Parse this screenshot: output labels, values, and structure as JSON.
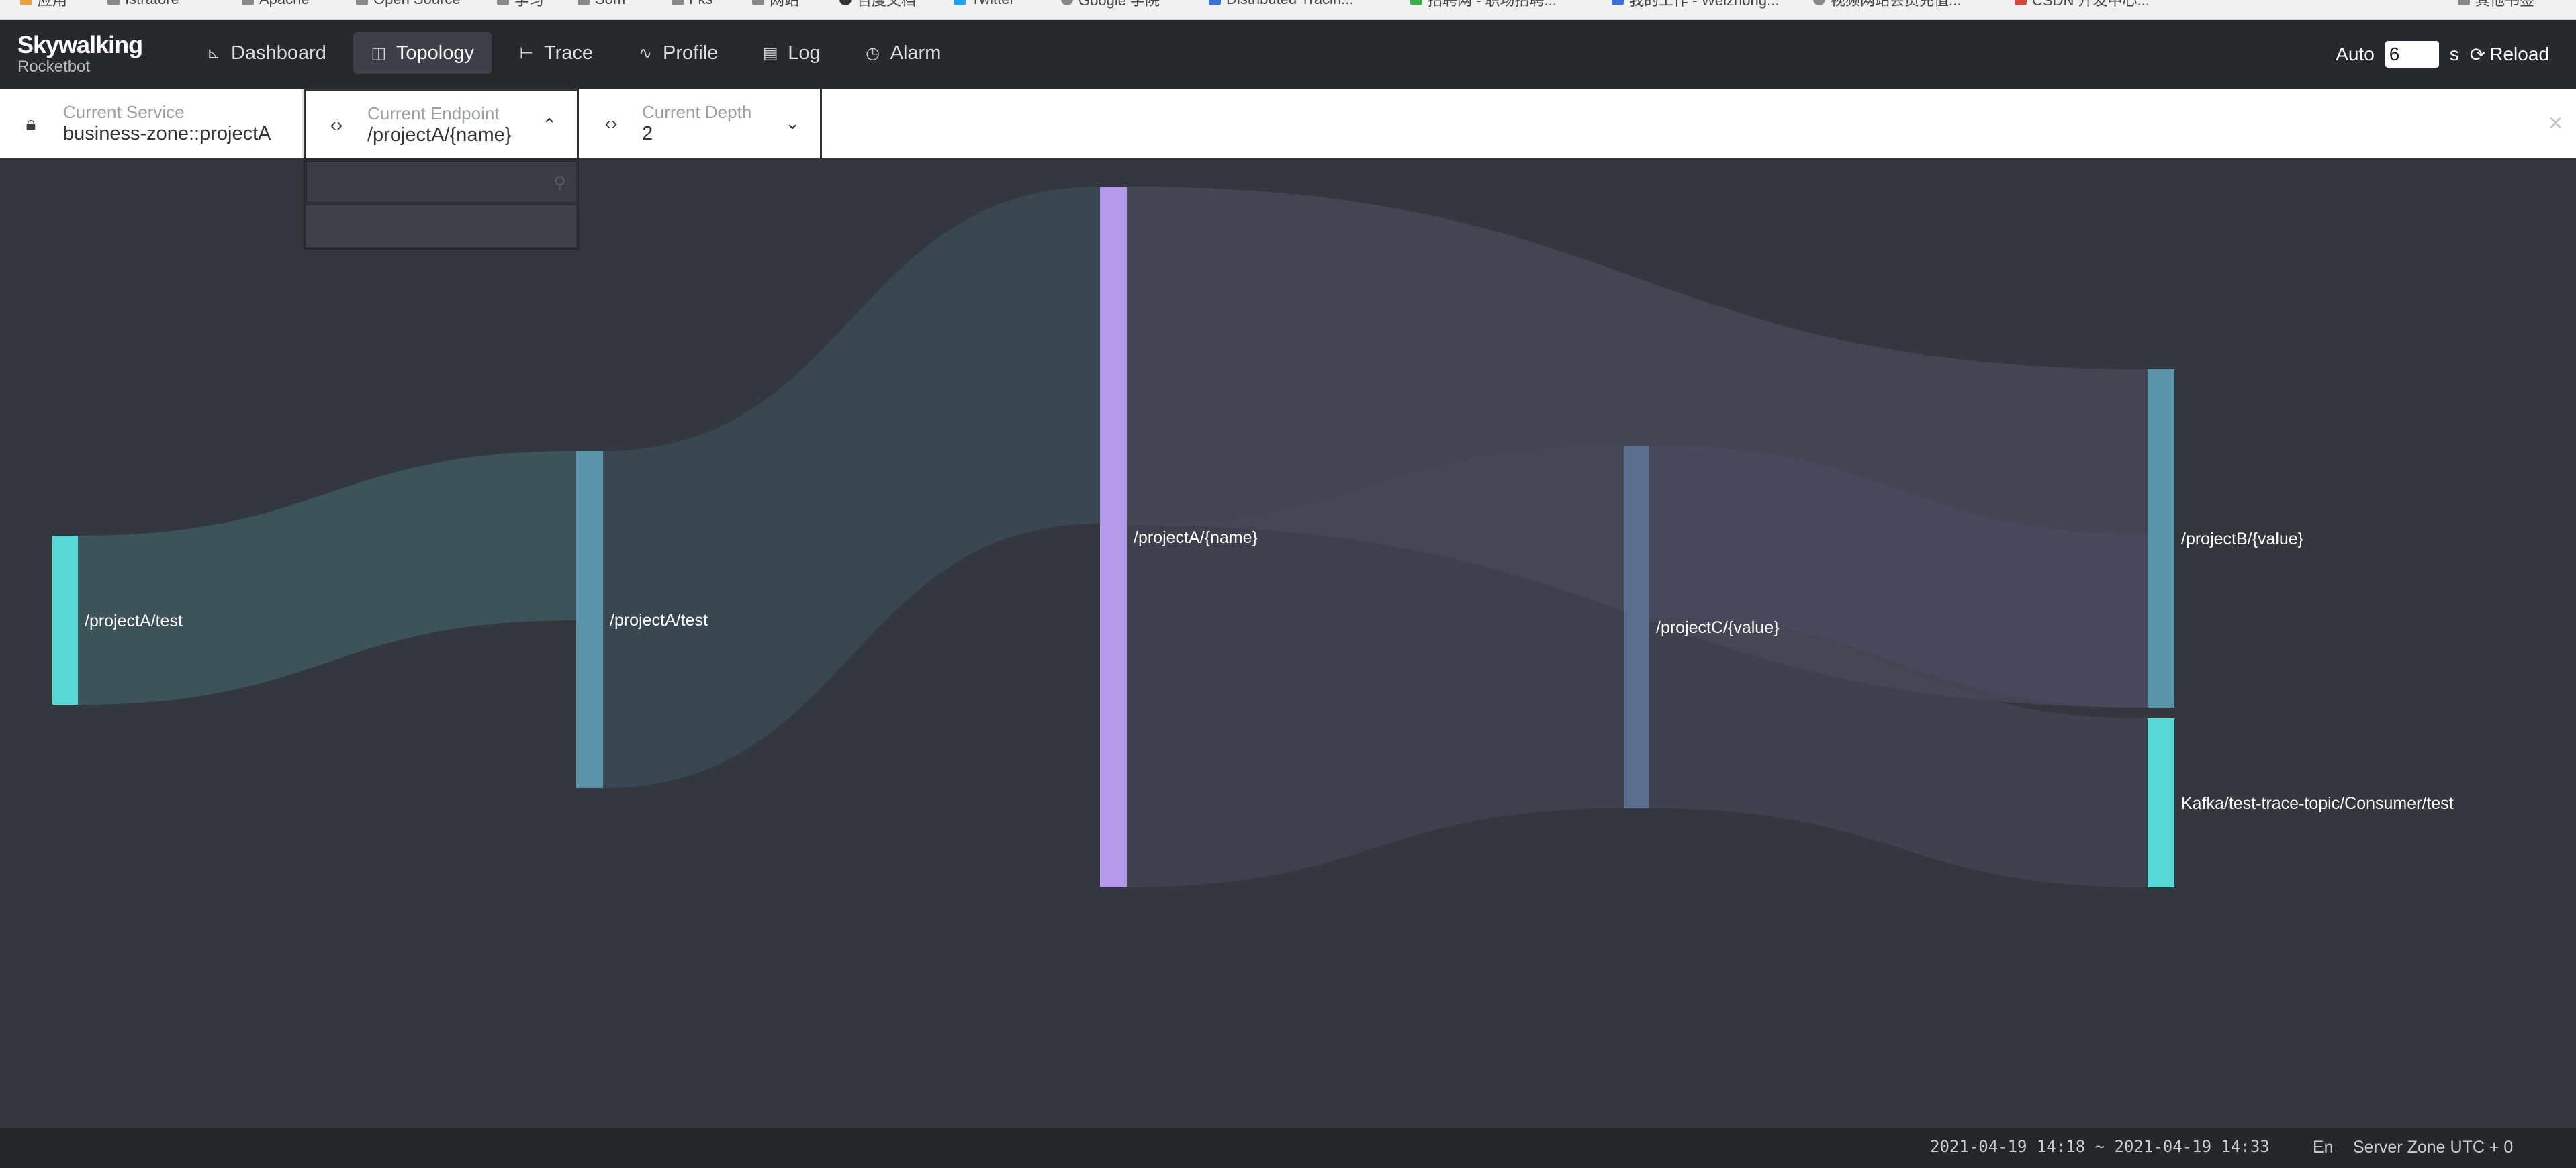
{
  "bookmarks": [
    "应用",
    "Istratore",
    "Apache",
    "Open Source",
    "学习",
    "Som",
    "Fks",
    "网站",
    "百度文档",
    "Twitter",
    "Google 学院",
    "Distributed Tracin...",
    "招聘网 - 职场招聘...",
    "我的工作 - Weizhong...",
    "视频网站会员充值...",
    "CSDN 开发中心..."
  ],
  "bookmarks_right": "其他书签",
  "logo": {
    "main": "Skywalking",
    "sub": "Rocketbot"
  },
  "nav": [
    {
      "label": "Dashboard",
      "icon": "chart-icon"
    },
    {
      "label": "Topology",
      "icon": "topology-icon"
    },
    {
      "label": "Trace",
      "icon": "trace-icon"
    },
    {
      "label": "Profile",
      "icon": "profile-icon"
    },
    {
      "label": "Log",
      "icon": "log-icon"
    },
    {
      "label": "Alarm",
      "icon": "alarm-icon"
    }
  ],
  "header": {
    "auto_label": "Auto",
    "auto_value": "6",
    "auto_unit": "s",
    "reload_label": "Reload"
  },
  "toolbar": {
    "service": {
      "label": "Current Service",
      "value": "business-zone::projectA"
    },
    "endpoint": {
      "label": "Current Endpoint",
      "value": "/projectA/{name}"
    },
    "depth": {
      "label": "Current Depth",
      "value": "2"
    },
    "close": "×"
  },
  "sankey": {
    "nodes": [
      {
        "id": "n1",
        "label": "/projectA/test",
        "color": "#5ad8d8"
      },
      {
        "id": "n2",
        "label": "/projectA/test",
        "color": "#5b93ad"
      },
      {
        "id": "n3",
        "label": "/projectA/{name}",
        "color": "#b39ae8"
      },
      {
        "id": "n4",
        "label": "/projectC/{value}",
        "color": "#5a6f8f"
      },
      {
        "id": "n5",
        "label": "/projectB/{value}",
        "color": "#5b93ad"
      },
      {
        "id": "n6",
        "label": "Kafka/test-trace-topic/Consumer/test",
        "color": "#5ad8d8"
      }
    ],
    "links": [
      {
        "source": "n1",
        "target": "n2"
      },
      {
        "source": "n2",
        "target": "n3"
      },
      {
        "source": "n3",
        "target": "n5"
      },
      {
        "source": "n3",
        "target": "n4"
      },
      {
        "source": "n4",
        "target": "n5"
      },
      {
        "source": "n4",
        "target": "n6"
      }
    ]
  },
  "footer": {
    "time_range": "2021-04-19 14:18 ~ 2021-04-19 14:33",
    "lang": "En",
    "server_zone": "Server Zone UTC + 0"
  }
}
